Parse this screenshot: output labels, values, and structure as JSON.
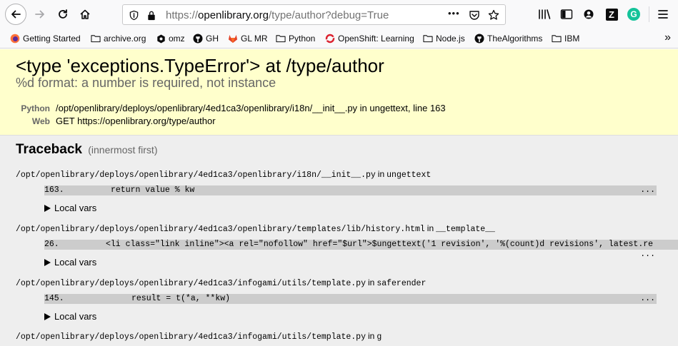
{
  "browser": {
    "url_scheme": "https://",
    "url_host": "openlibrary.org",
    "url_path": "/type/author?debug=True",
    "url_more": "•••",
    "bookmarks": [
      {
        "label": "Getting Started",
        "icon": "firefox-icon"
      },
      {
        "label": "archive.org",
        "icon": "folder-icon"
      },
      {
        "label": "omz",
        "icon": "gear-icon"
      },
      {
        "label": "GH",
        "icon": "github-icon"
      },
      {
        "label": "GL MR",
        "icon": "gitlab-icon"
      },
      {
        "label": "Python",
        "icon": "folder-icon"
      },
      {
        "label": "OpenShift: Learning",
        "icon": "openshift-icon"
      },
      {
        "label": "Node.js",
        "icon": "folder-icon"
      },
      {
        "label": "TheAlgorithms",
        "icon": "github-icon"
      },
      {
        "label": "IBM",
        "icon": "folder-icon"
      }
    ],
    "overflow": "»",
    "toolbar_letter_z": "Z",
    "toolbar_letter_g": "G",
    "colors": {
      "grammarly": "#15c39a",
      "gitlab": "#e2432a",
      "openshift": "#db212e",
      "firefox": "#ff7139"
    }
  },
  "error": {
    "title": "<type 'exceptions.TypeError'> at /type/author",
    "message": "%d format: a number is required, not instance",
    "python_label": "Python",
    "python_value": "/opt/openlibrary/deploys/openlibrary/4ed1ca3/openlibrary/i18n/__init__.py in ungettext, line 163",
    "web_label": "Web",
    "web_value": "GET https://openlibrary.org/type/author"
  },
  "traceback": {
    "heading": "Traceback",
    "subheading": "(innermost first)",
    "in_word": "in",
    "local_vars": "Local vars",
    "frames": [
      {
        "file": "/opt/openlibrary/deploys/openlibrary/4ed1ca3/openlibrary/i18n/__init__.py",
        "func": "ungettext",
        "lineno": "163.",
        "code": "return value % kw",
        "ellipsis": "..."
      },
      {
        "file": "/opt/openlibrary/deploys/openlibrary/4ed1ca3/openlibrary/templates/lib/history.html",
        "func": "__template__",
        "lineno": "26.",
        "code": "<li class=\"link inline\"><a rel=\"nofollow\" href=\"$url\">$ungettext('1 revision', '%(count)d revisions', latest.re",
        "ellipsis": "..."
      },
      {
        "file": "/opt/openlibrary/deploys/openlibrary/4ed1ca3/infogami/utils/template.py",
        "func": "saferender",
        "lineno": "145.",
        "code": "result = t(*a, **kw)",
        "ellipsis": "..."
      },
      {
        "file": "/opt/openlibrary/deploys/openlibrary/4ed1ca3/infogami/utils/template.py",
        "func": "g"
      }
    ]
  }
}
